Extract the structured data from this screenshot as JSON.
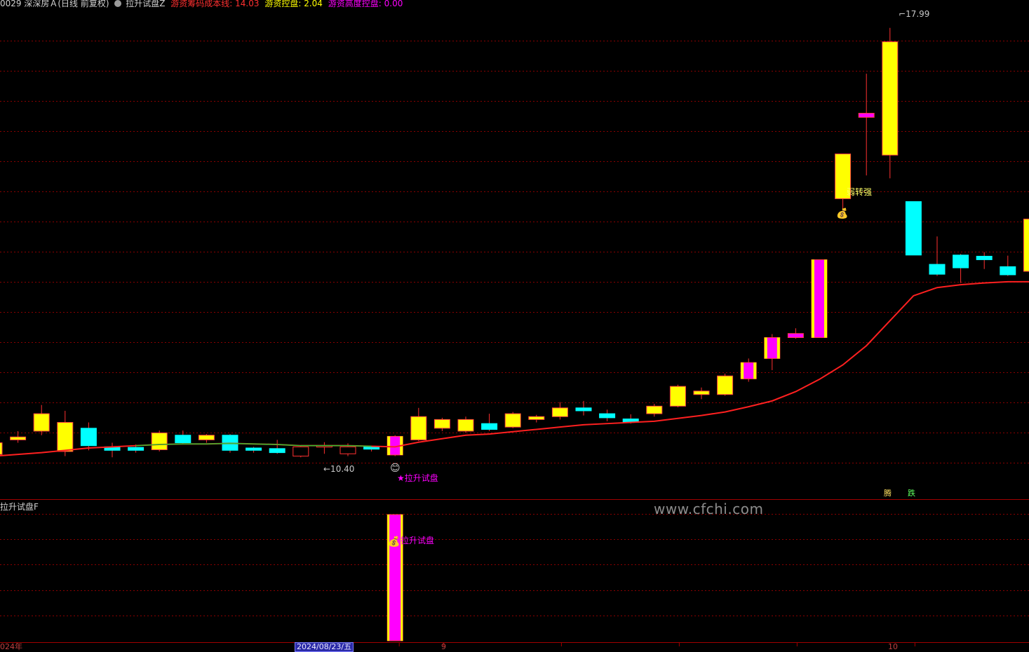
{
  "header": {
    "stock": "0029 深深房Ａ(日线 前复权)",
    "indicator_name": "拉升试盘Z",
    "cost_line_label": "游资筹码成本线:",
    "cost_line_value": "14.03",
    "control_label": "游资控盘:",
    "control_value": "2.04",
    "height_label": "游资高度控盘:",
    "height_value": "0.00"
  },
  "subchart": {
    "title": "拉升试盘F"
  },
  "annotations": {
    "high_price": "17.99",
    "low_price": "←10.40",
    "signal_main": "★拉升试盘",
    "signal_sub": "拉升试盘",
    "weak_to_strong": "弱转强",
    "btn_rise": "腾",
    "btn_fall": "跌"
  },
  "watermark": "www.cfchi.com",
  "time_axis": {
    "year_label": "024年",
    "date_label": "2024/08/23/五",
    "month_sep": "9",
    "month_oct": "10"
  },
  "colors": {
    "up": "#ffff00",
    "down": "#00ffff",
    "magenta": "#ff00ff",
    "ma_line": "#ff2020",
    "grid": "#8b0000",
    "wick": "#ff3030"
  },
  "icons": [
    "money-bag-icon",
    "smiley-icon",
    "circle-check-icon"
  ],
  "chart_data": {
    "type": "candlestick",
    "ylim": [
      10.0,
      18.3
    ],
    "candles": [
      {
        "o": 10.65,
        "c": 10.85,
        "h": 10.9,
        "l": 10.5,
        "color": "up"
      },
      {
        "o": 10.9,
        "c": 10.95,
        "h": 11.05,
        "l": 10.85,
        "color": "up"
      },
      {
        "o": 11.05,
        "c": 11.35,
        "h": 11.5,
        "l": 10.98,
        "color": "up"
      },
      {
        "o": 10.7,
        "c": 11.2,
        "h": 11.4,
        "l": 10.62,
        "color": "up"
      },
      {
        "o": 11.1,
        "c": 10.8,
        "h": 11.2,
        "l": 10.72,
        "color": "down"
      },
      {
        "o": 10.78,
        "c": 10.72,
        "h": 10.85,
        "l": 10.6,
        "color": "down"
      },
      {
        "o": 10.77,
        "c": 10.72,
        "h": 10.82,
        "l": 10.68,
        "color": "down"
      },
      {
        "o": 10.73,
        "c": 11.02,
        "h": 11.06,
        "l": 10.7,
        "color": "up"
      },
      {
        "o": 10.98,
        "c": 10.85,
        "h": 11.06,
        "l": 10.83,
        "color": "down"
      },
      {
        "o": 10.9,
        "c": 10.98,
        "h": 11.0,
        "l": 10.85,
        "color": "up"
      },
      {
        "o": 10.98,
        "c": 10.72,
        "h": 11.0,
        "l": 10.68,
        "color": "down"
      },
      {
        "o": 10.76,
        "c": 10.72,
        "h": 10.78,
        "l": 10.68,
        "color": "down"
      },
      {
        "o": 10.75,
        "c": 10.68,
        "h": 10.9,
        "l": 10.66,
        "color": "down"
      },
      {
        "o": 10.78,
        "c": 10.62,
        "h": 10.8,
        "l": 10.6,
        "color": "down_hollow"
      },
      {
        "o": 10.8,
        "c": 10.78,
        "h": 10.86,
        "l": 10.66,
        "color": "down_hollow"
      },
      {
        "o": 10.78,
        "c": 10.66,
        "h": 10.84,
        "l": 10.62,
        "color": "down_hollow"
      },
      {
        "o": 10.74,
        "c": 10.78,
        "h": 10.8,
        "l": 10.7,
        "color": "down"
      },
      {
        "o": 10.64,
        "c": 10.96,
        "h": 10.98,
        "l": 10.62,
        "color": "magenta"
      },
      {
        "o": 10.9,
        "c": 11.3,
        "h": 11.45,
        "l": 10.88,
        "color": "up"
      },
      {
        "o": 11.1,
        "c": 11.25,
        "h": 11.28,
        "l": 11.05,
        "color": "up"
      },
      {
        "o": 11.05,
        "c": 11.25,
        "h": 11.3,
        "l": 11.02,
        "color": "up"
      },
      {
        "o": 11.18,
        "c": 11.08,
        "h": 11.35,
        "l": 11.05,
        "color": "down"
      },
      {
        "o": 11.12,
        "c": 11.35,
        "h": 11.38,
        "l": 11.1,
        "color": "up"
      },
      {
        "o": 11.25,
        "c": 11.3,
        "h": 11.33,
        "l": 11.2,
        "color": "up"
      },
      {
        "o": 11.3,
        "c": 11.45,
        "h": 11.55,
        "l": 11.25,
        "color": "up"
      },
      {
        "o": 11.45,
        "c": 11.4,
        "h": 11.57,
        "l": 11.32,
        "color": "down"
      },
      {
        "o": 11.35,
        "c": 11.28,
        "h": 11.42,
        "l": 11.22,
        "color": "down"
      },
      {
        "o": 11.26,
        "c": 11.2,
        "h": 11.34,
        "l": 11.18,
        "color": "down"
      },
      {
        "o": 11.35,
        "c": 11.48,
        "h": 11.52,
        "l": 11.3,
        "color": "up"
      },
      {
        "o": 11.48,
        "c": 11.82,
        "h": 11.85,
        "l": 11.46,
        "color": "up"
      },
      {
        "o": 11.68,
        "c": 11.74,
        "h": 11.8,
        "l": 11.6,
        "color": "up"
      },
      {
        "o": 11.68,
        "c": 12.0,
        "h": 12.04,
        "l": 11.66,
        "color": "up"
      },
      {
        "o": 11.95,
        "c": 12.23,
        "h": 12.3,
        "l": 11.9,
        "color": "magenta"
      },
      {
        "o": 12.3,
        "c": 12.66,
        "h": 12.72,
        "l": 12.1,
        "color": "magenta"
      },
      {
        "o": 12.66,
        "c": 12.73,
        "h": 12.82,
        "l": 12.64,
        "color": "magenta"
      },
      {
        "o": 12.66,
        "c": 14.0,
        "h": 14.0,
        "l": 12.66,
        "color": "magenta"
      },
      {
        "o": 15.05,
        "c": 15.82,
        "h": 15.82,
        "l": 14.8,
        "color": "up"
      },
      {
        "o": 16.45,
        "c": 16.52,
        "h": 17.2,
        "l": 15.45,
        "color": "magenta"
      },
      {
        "o": 15.8,
        "c": 17.75,
        "h": 17.99,
        "l": 15.4,
        "color": "up"
      },
      {
        "o": 15.0,
        "c": 14.08,
        "h": 15.0,
        "l": 14.08,
        "color": "down"
      },
      {
        "o": 13.92,
        "c": 13.75,
        "h": 14.4,
        "l": 13.72,
        "color": "down"
      },
      {
        "o": 14.08,
        "c": 13.86,
        "h": 14.1,
        "l": 13.6,
        "color": "down"
      },
      {
        "o": 14.06,
        "c": 14.0,
        "h": 14.13,
        "l": 13.84,
        "color": "down"
      },
      {
        "o": 13.88,
        "c": 13.74,
        "h": 14.07,
        "l": 13.72,
        "color": "down"
      },
      {
        "o": 13.8,
        "c": 14.7,
        "h": 14.7,
        "l": 13.78,
        "color": "up"
      }
    ],
    "ma_line": [
      10.62,
      10.65,
      10.68,
      10.72,
      10.76,
      10.78,
      10.8,
      10.82,
      10.83,
      10.83,
      10.84,
      10.83,
      10.82,
      10.8,
      10.8,
      10.8,
      10.79,
      10.78,
      10.86,
      10.92,
      10.98,
      11.0,
      11.04,
      11.08,
      11.12,
      11.16,
      11.18,
      11.2,
      11.22,
      11.27,
      11.32,
      11.38,
      11.47,
      11.57,
      11.73,
      11.94,
      12.19,
      12.52,
      12.95,
      13.38,
      13.52,
      13.57,
      13.6,
      13.62,
      13.62,
      13.62,
      13.65
    ]
  }
}
